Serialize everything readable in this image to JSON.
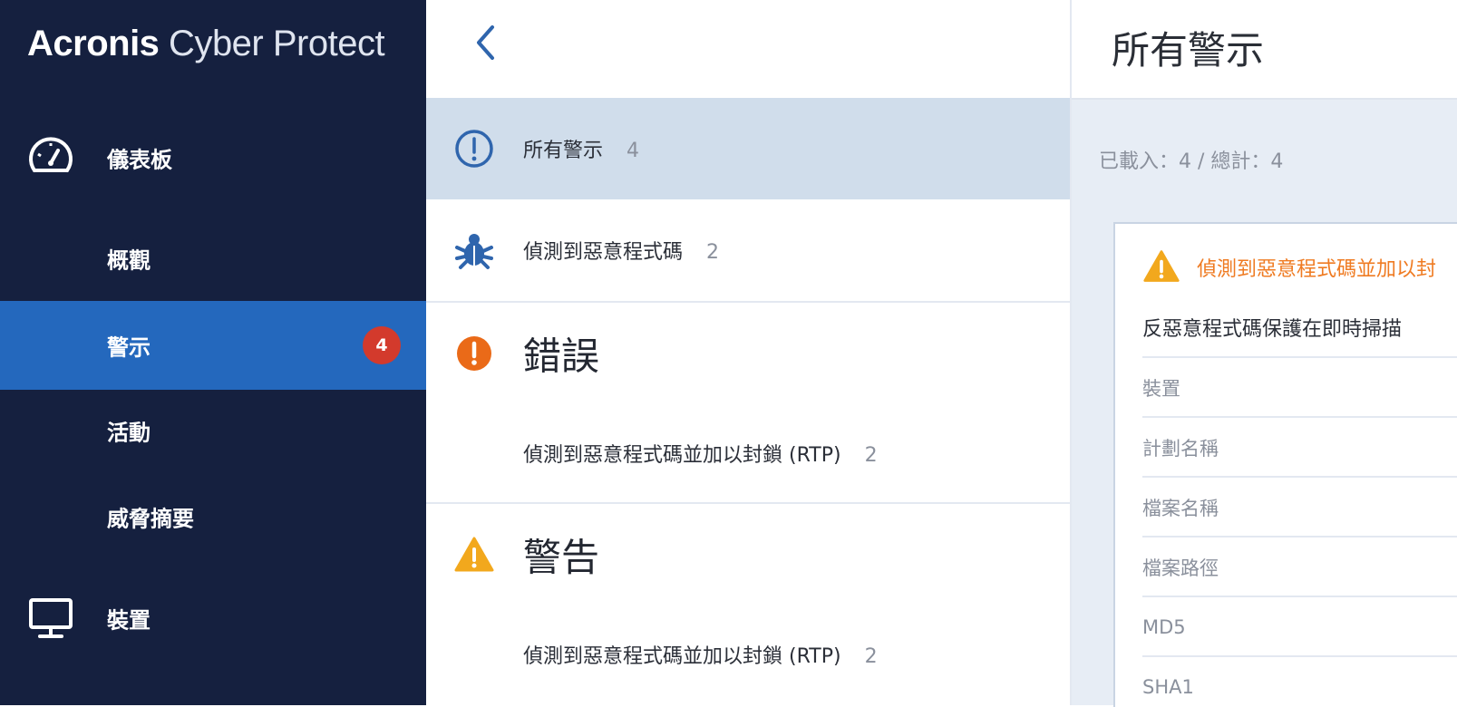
{
  "brand": {
    "bold": "Acronis",
    "light": " Cyber Protect"
  },
  "sidebar": {
    "items": [
      {
        "label": "儀表板",
        "icon": "dashboard-gauge-icon"
      },
      {
        "label": "概觀"
      },
      {
        "label": "警示",
        "badge": "4",
        "active": true
      },
      {
        "label": "活動"
      },
      {
        "label": "威脅摘要"
      },
      {
        "label": "裝置",
        "icon": "monitor-icon"
      }
    ]
  },
  "middle": {
    "all_alerts": {
      "label": "所有警示",
      "count": "4",
      "icon": "exclamation-circle-icon"
    },
    "malware": {
      "label": "偵測到惡意程式碼",
      "count": "2",
      "icon": "bug-icon"
    },
    "error_section": {
      "title": "錯誤",
      "icon": "error-circle-icon"
    },
    "error_item": {
      "label": "偵測到惡意程式碼並加以封鎖 (RTP)",
      "count": "2"
    },
    "warning_section": {
      "title": "警告",
      "icon": "warning-triangle-icon"
    },
    "warning_item": {
      "label": "偵測到惡意程式碼並加以封鎖 (RTP)",
      "count": "2"
    }
  },
  "right": {
    "title": "所有警示",
    "loaded": "已載入：4 / 總計：4",
    "card": {
      "title": "偵測到惡意程式碼並加以封",
      "description": "反惡意程式碼保護在即時掃描",
      "fields": [
        "裝置",
        "計劃名稱",
        "檔案名稱",
        "檔案路徑",
        "MD5",
        "SHA1"
      ]
    }
  },
  "colors": {
    "sidebar_bg": "#15203f",
    "active_bg": "#2468bd",
    "badge_bg": "#d33a2c",
    "selected_row_bg": "#d0ddeb",
    "error_orange": "#ea6a18",
    "warning_amber": "#f2a81d",
    "accent_blue": "#2f65ad"
  }
}
